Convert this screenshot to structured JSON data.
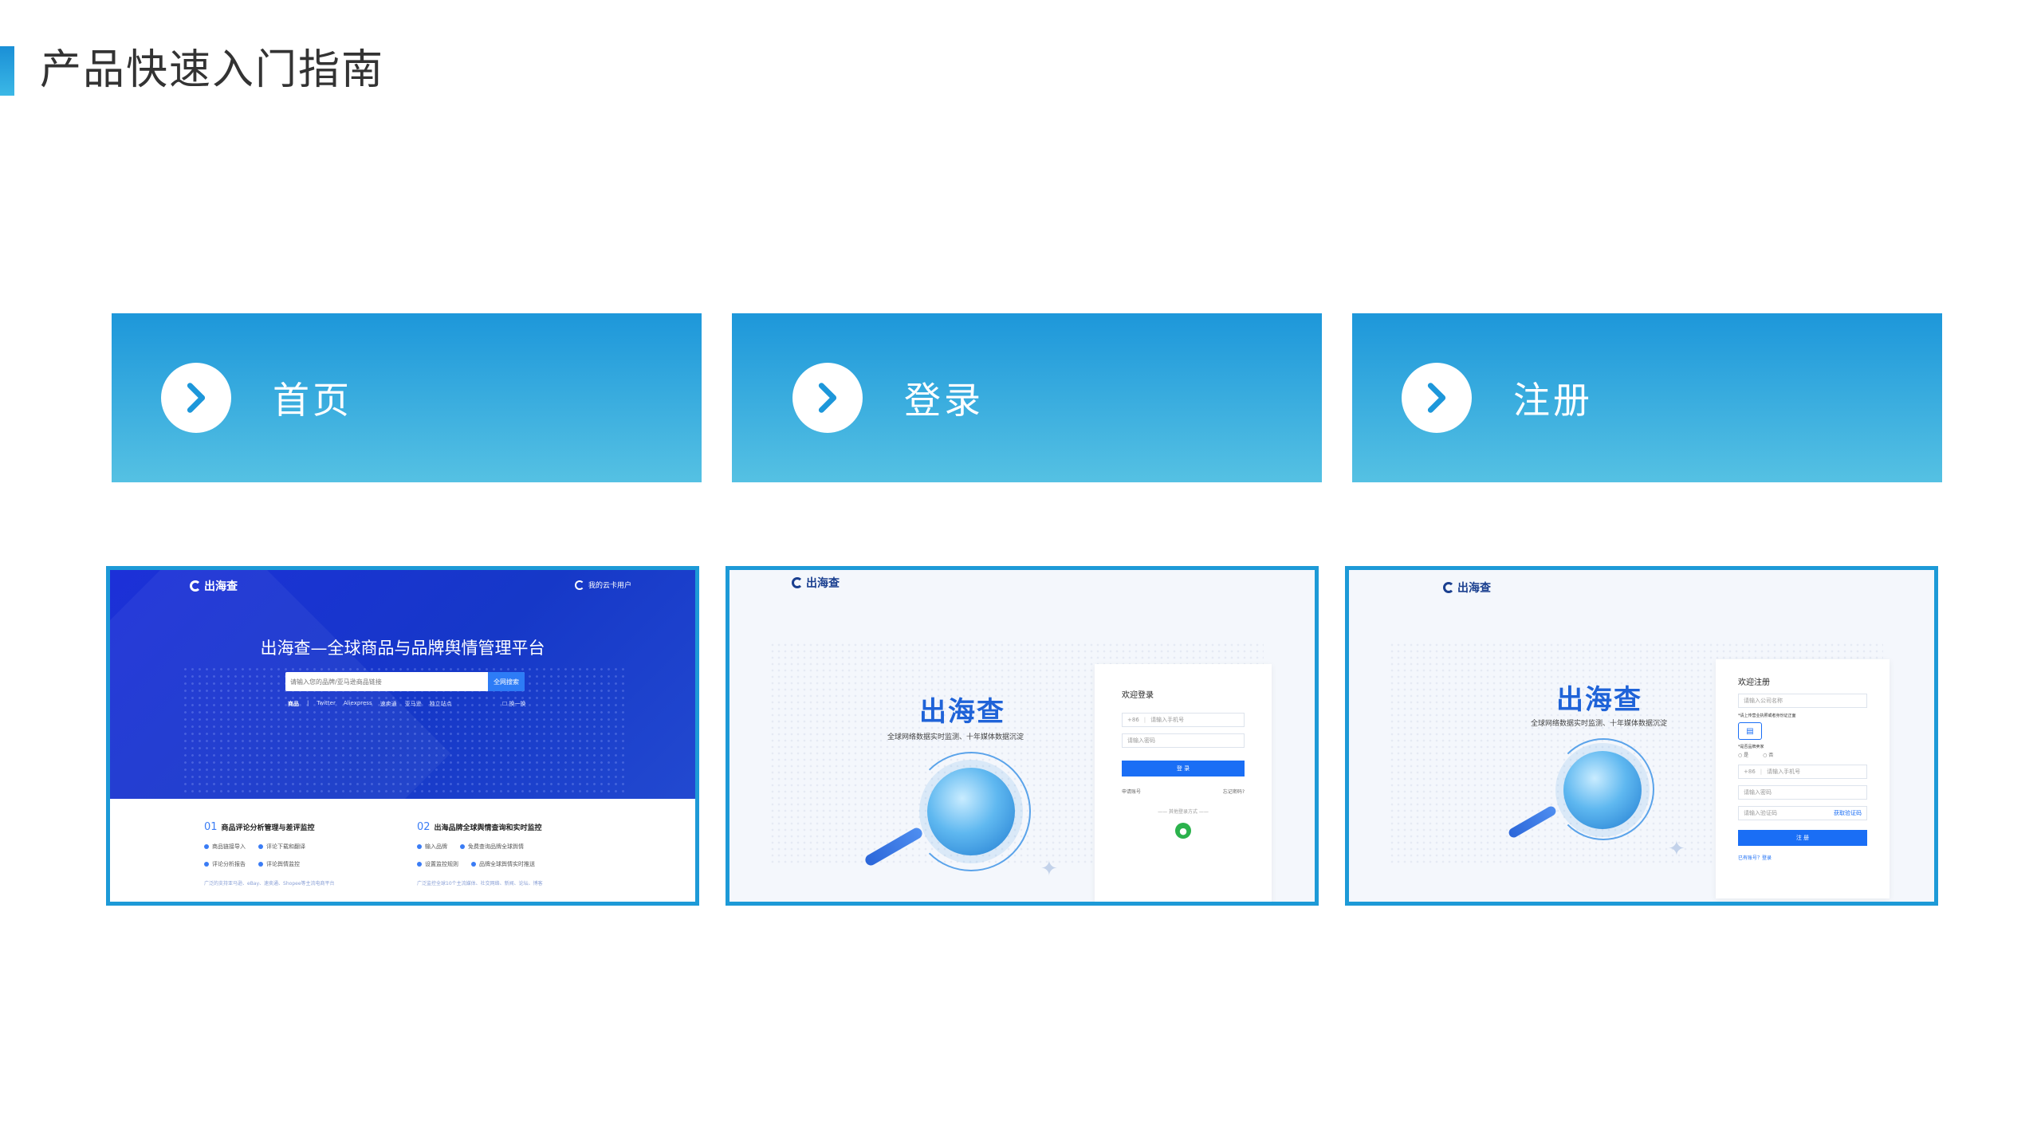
{
  "page": {
    "title": "产品快速入门指南"
  },
  "nav": [
    {
      "label": "首页"
    },
    {
      "label": "登录"
    },
    {
      "label": "注册"
    }
  ],
  "home": {
    "logo": "出海查",
    "user": "我的云卡用户",
    "headline": "出海查—全球商品与品牌舆情管理平台",
    "search_placeholder": "请输入您的品牌/亚马逊商品链接",
    "search_button": "全网搜索",
    "quick": [
      "商品",
      "Twitter",
      "Aliexpress",
      "速卖通",
      "亚马逊",
      "独立站点"
    ],
    "quick_right": "换一换",
    "features": [
      {
        "num": "01",
        "title": "商品评论分析管理与差评监控",
        "row1": [
          "商品链接导入",
          "评论下载和翻译"
        ],
        "row2": [
          "评论分析报告",
          "评论舆情监控"
        ],
        "foot": "广泛的支持亚马逊、eBay、速卖通、Shopee等主流电商平台"
      },
      {
        "num": "02",
        "title": "出海品牌全球舆情查询和实时监控",
        "row1": [
          "输入品牌",
          "免费查询品牌全球舆情"
        ],
        "row2": [
          "设置监控规则",
          "品牌全球舆情实时推送"
        ],
        "foot": "广泛监控全球10个主流媒体、社交网络、新闻、论坛、博客"
      }
    ]
  },
  "login": {
    "logo": "出海查",
    "brand": "出海查",
    "subtitle": "全球网络数据实时监测、十年媒体数据沉淀",
    "form_title": "欢迎登录",
    "phone_prefix": "+86",
    "phone_placeholder": "请输入手机号",
    "password_placeholder": "请输入密码",
    "submit": "登 录",
    "register_link": "申请账号",
    "forgot_link": "忘记密码?",
    "other": "其他登录方式"
  },
  "register": {
    "logo": "出海查",
    "brand": "出海查",
    "subtitle": "全球网络数据实时监测、十年媒体数据沉淀",
    "form_title": "欢迎注册",
    "company_placeholder": "请输入公司名称",
    "license_note": "*请上传营业执照或者身份证正面",
    "brand_note": "*是否品牌卖家",
    "opt_yes": "是",
    "opt_no": "否",
    "phone_prefix": "+86",
    "phone_placeholder": "请输入手机号",
    "password_placeholder": "请输入密码",
    "code_placeholder": "请输入验证码",
    "code_button": "获取验证码",
    "submit": "注 册",
    "login_link": "已有账号？登录"
  },
  "colors": {
    "accent": "#1d9ad7",
    "primary": "#1a6ef5",
    "home_hero": "#1c30d8"
  }
}
